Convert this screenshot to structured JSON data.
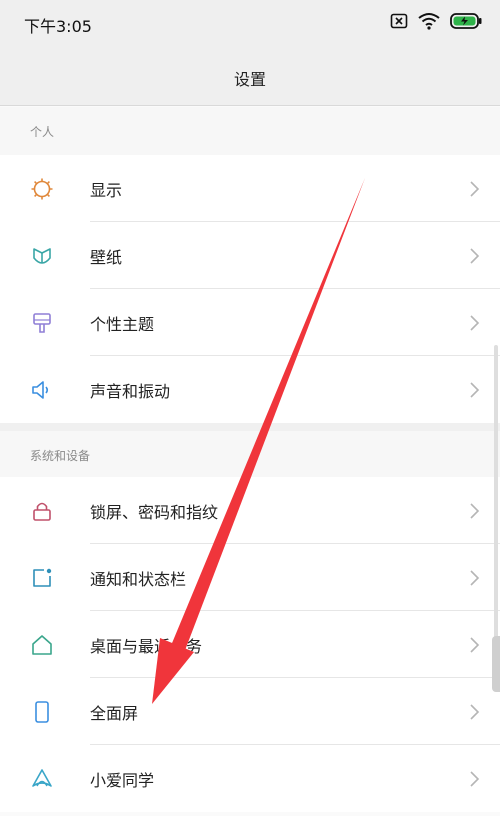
{
  "status": {
    "time": "下午3:05",
    "icons": [
      "sim-off-icon",
      "wifi-icon",
      "battery-charging-icon"
    ]
  },
  "header": {
    "title": "设置"
  },
  "sections": [
    {
      "label": "个人",
      "items": [
        {
          "label": "显示",
          "icon": "brightness-icon",
          "color": "#e0883b"
        },
        {
          "label": "壁纸",
          "icon": "wallpaper-icon",
          "color": "#3aa6a6"
        },
        {
          "label": "个性主题",
          "icon": "theme-brush-icon",
          "color": "#8f7fd6"
        },
        {
          "label": "声音和振动",
          "icon": "speaker-icon",
          "color": "#3b8fe0"
        }
      ]
    },
    {
      "label": "系统和设备",
      "items": [
        {
          "label": "锁屏、密码和指纹",
          "icon": "lock-icon",
          "color": "#c0506a"
        },
        {
          "label": "通知和状态栏",
          "icon": "notification-icon",
          "color": "#2e8fb8"
        },
        {
          "label": "桌面与最近任务",
          "icon": "home-icon",
          "color": "#3aa68c"
        },
        {
          "label": "全面屏",
          "icon": "phone-icon",
          "color": "#3b8fe0"
        },
        {
          "label": "小爱同学",
          "icon": "xiaoai-icon",
          "color": "#3aa6c8"
        }
      ]
    }
  ],
  "annotation": {
    "color": "#f0353b",
    "icon": "red-arrow-annotation"
  }
}
